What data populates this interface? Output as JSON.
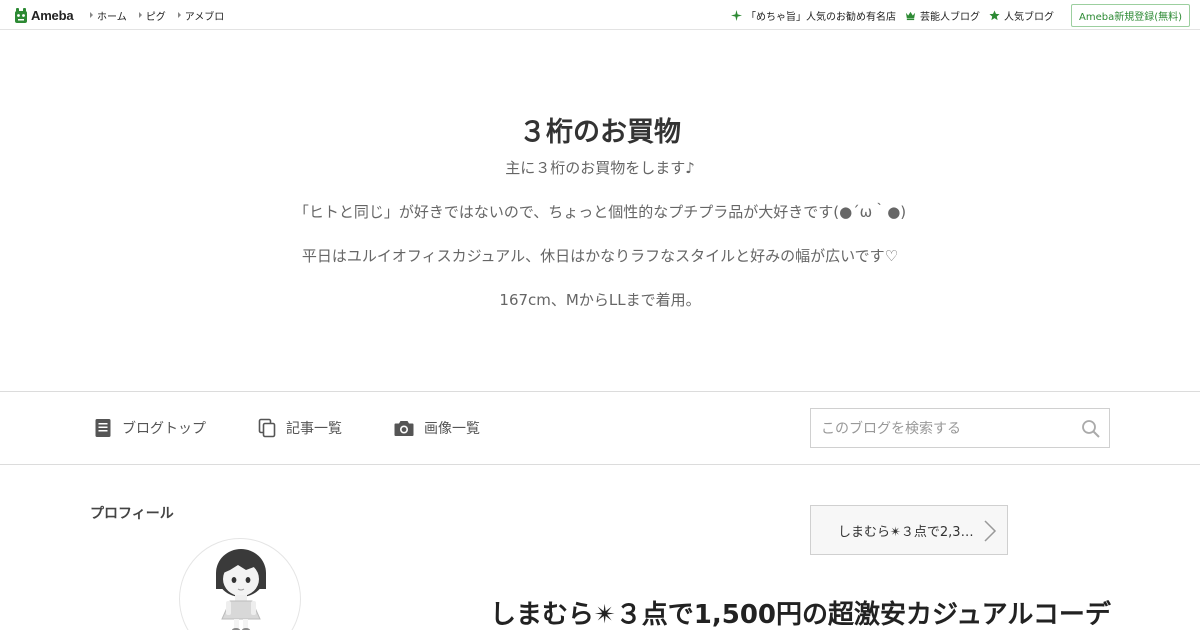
{
  "topbar": {
    "logo_text": "Ameba",
    "nav_left": [
      "ホーム",
      "ピグ",
      "アメブロ"
    ],
    "nav_right": [
      {
        "label": "「めちゃ旨」人気のお勧め有名店",
        "icon": "sparkle-icon",
        "color": "#2d8a34"
      },
      {
        "label": "芸能人ブログ",
        "icon": "crown-icon",
        "color": "#2d8a34"
      },
      {
        "label": "人気ブログ",
        "icon": "star-icon",
        "color": "#2d8a34"
      }
    ],
    "signup_label": "Ameba新規登録(無料)"
  },
  "header": {
    "title": "３桁のお買物",
    "description": [
      "主に３桁のお買物をします♪",
      "「ヒトと同じ」が好きではないので、ちょっと個性的なプチプラ品が大好きです(●´ω｀●)",
      "平日はユルイオフィスカジュアル、休日はかなりラフなスタイルと好みの幅が広いです♡",
      "167cm、MからLLまで着用。"
    ]
  },
  "blognav": {
    "items": [
      {
        "label": "ブログトップ",
        "icon": "document-icon"
      },
      {
        "label": "記事一覧",
        "icon": "copy-icon"
      },
      {
        "label": "画像一覧",
        "icon": "camera-icon"
      }
    ],
    "search_placeholder": "このブログを検索する"
  },
  "sidebar": {
    "profile_heading": "プロフィール"
  },
  "main": {
    "next_post_label": "しまむら✴３点で2,3…",
    "entry_title": "しまむら✴３点で1,500円の超激安カジュアルコーデ"
  },
  "colors": {
    "brand_green": "#2d8a34",
    "divider": "#dcdcdc",
    "text": "#333333"
  }
}
